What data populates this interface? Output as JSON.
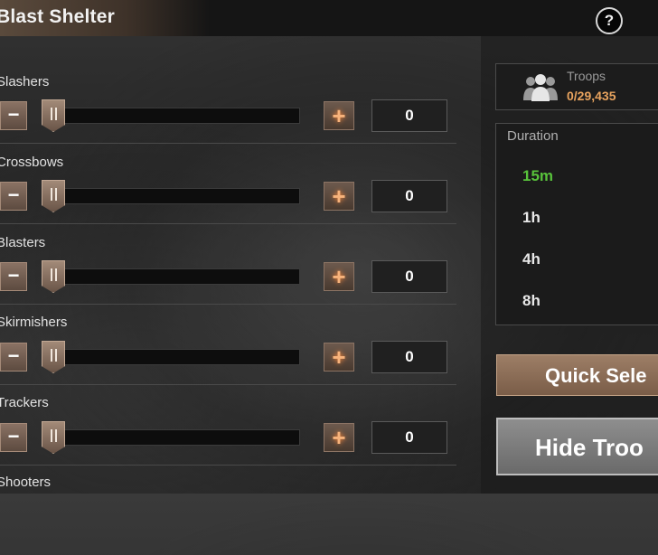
{
  "header": {
    "title": "Blast Shelter",
    "help_label": "?"
  },
  "troop_rows": [
    {
      "label": "Slashers",
      "count": "0",
      "minus": "−",
      "plus": "+"
    },
    {
      "label": "Crossbows",
      "count": "0",
      "minus": "−",
      "plus": "+"
    },
    {
      "label": "Blasters",
      "count": "0",
      "minus": "−",
      "plus": "+"
    },
    {
      "label": "Skirmishers",
      "count": "0",
      "minus": "−",
      "plus": "+"
    },
    {
      "label": "Trackers",
      "count": "0",
      "minus": "−",
      "plus": "+"
    },
    {
      "label": "Shooters"
    }
  ],
  "sliders": [
    0,
    0,
    0,
    0,
    0
  ],
  "troops": {
    "label": "Troops",
    "value": "0/29,435",
    "icon": "troops-icon"
  },
  "duration": {
    "label": "Duration",
    "options": [
      "15m",
      "1h",
      "4h",
      "8h"
    ],
    "selected": "15m"
  },
  "buttons": {
    "quick_select": "Quick Sele",
    "hide_troops": "Hide Troo"
  },
  "colors": {
    "accent": "#e8a35e",
    "selected": "#58c23b",
    "plus_glow": "#f7b37c"
  }
}
